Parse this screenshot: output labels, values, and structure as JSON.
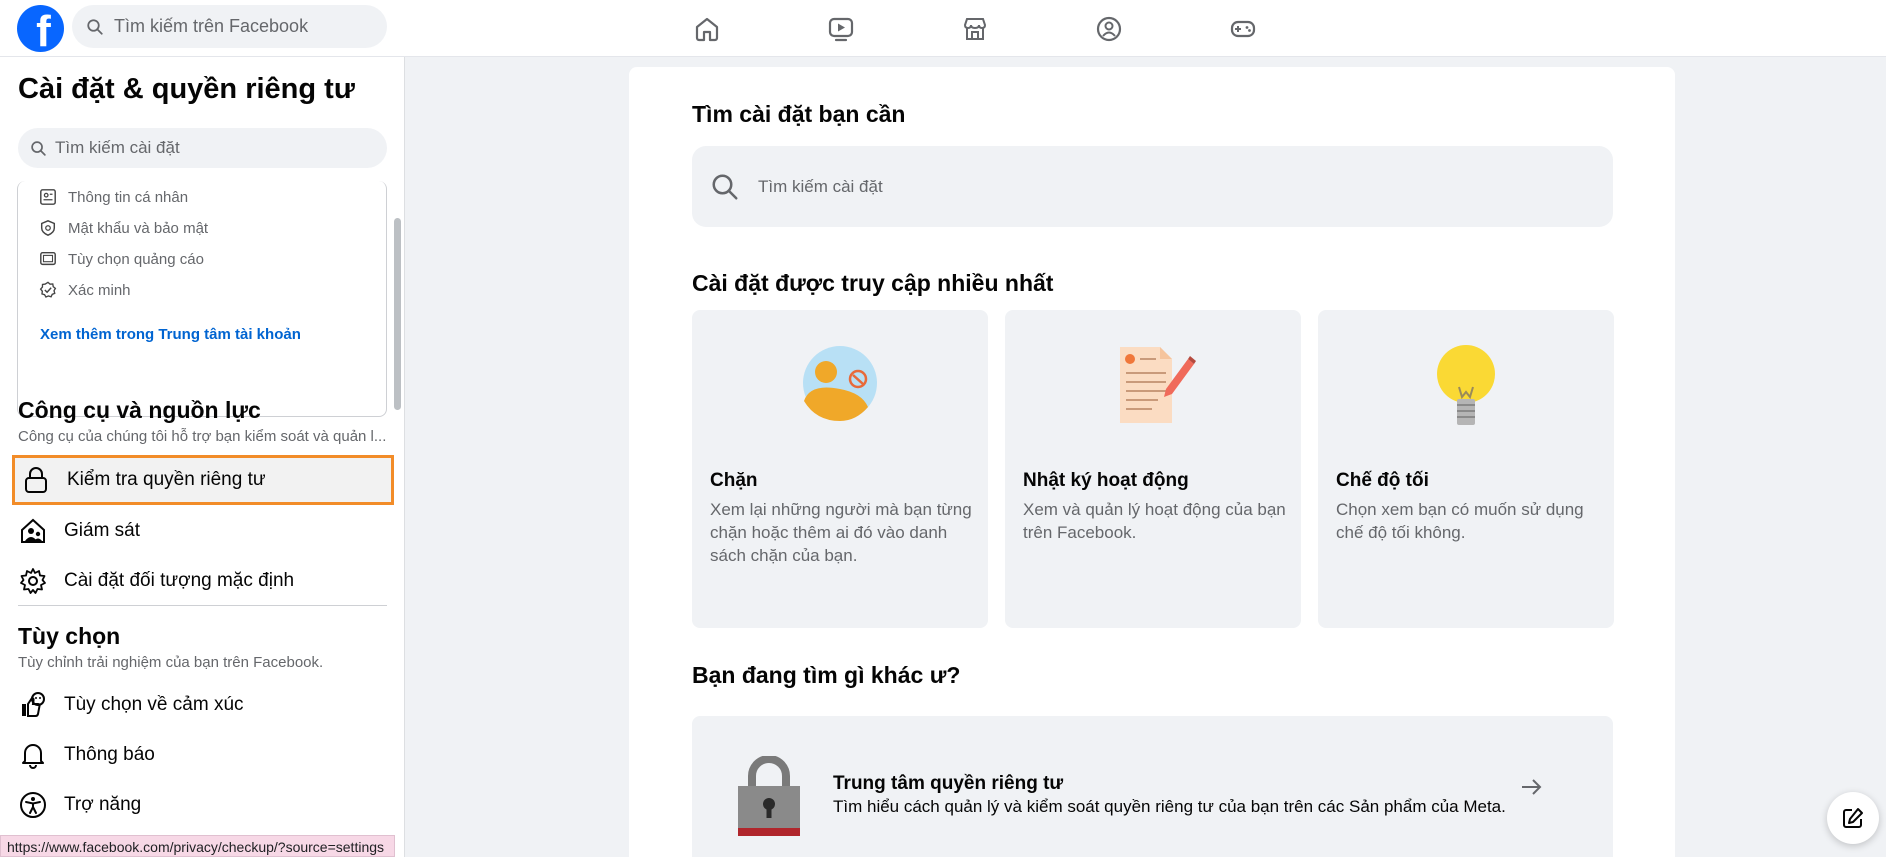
{
  "topbar": {
    "logo_letter": "f",
    "search_placeholder": "Tìm kiếm trên Facebook",
    "nav": [
      "home-icon",
      "video-icon",
      "marketplace-icon",
      "groups-icon",
      "gaming-icon"
    ]
  },
  "sidebar": {
    "title": "Cài đặt & quyền riêng tư",
    "search_placeholder": "Tìm kiếm cài đặt",
    "account_items": [
      {
        "label": "Thông tin cá nhân",
        "icon": "id-card-icon"
      },
      {
        "label": "Mật khẩu và bảo mật",
        "icon": "shield-icon"
      },
      {
        "label": "Tùy chọn quảng cáo",
        "icon": "monitor-icon"
      },
      {
        "label": "Xác minh",
        "icon": "verified-badge-icon"
      }
    ],
    "account_link": "Xem thêm trong Trung tâm tài khoản",
    "tools_section": {
      "title": "Công cụ và nguồn lực",
      "subtitle": "Công cụ của chúng tôi hỗ trợ bạn kiểm soát và quản l...",
      "items": [
        {
          "label": "Kiểm tra quyền riêng tư",
          "icon": "lock-icon",
          "active": true
        },
        {
          "label": "Giám sát",
          "icon": "supervision-icon"
        },
        {
          "label": "Cài đặt đối tượng mặc định",
          "icon": "gear-icon"
        }
      ]
    },
    "prefs_section": {
      "title": "Tùy chọn",
      "subtitle": "Tùy chỉnh trải nghiệm của bạn trên Facebook.",
      "items": [
        {
          "label": "Tùy chọn về cảm xúc",
          "icon": "reactions-icon"
        },
        {
          "label": "Thông báo",
          "icon": "bell-icon"
        },
        {
          "label": "Trợ năng",
          "icon": "accessibility-icon"
        }
      ]
    }
  },
  "main": {
    "search_heading": "Tìm cài đặt bạn cần",
    "search_placeholder": "Tìm kiếm cài đặt",
    "most_visited_heading": "Cài đặt được truy cập nhiều nhất",
    "cards": [
      {
        "title": "Chặn",
        "desc": "Xem lại những người mà bạn từng chặn hoặc thêm ai đó vào danh sách chặn của bạn."
      },
      {
        "title": "Nhật ký hoạt động",
        "desc": "Xem và quản lý hoạt động của bạn trên Facebook."
      },
      {
        "title": "Chế độ tối",
        "desc": "Chọn xem bạn có muốn sử dụng chế độ tối không."
      }
    ],
    "other_heading": "Bạn đang tìm gì khác ư?",
    "privacy_center": {
      "title": "Trung tâm quyền riêng tư",
      "desc": "Tìm hiểu cách quản lý và kiểm soát quyền riêng tư của bạn trên các Sản phẩm của Meta."
    }
  },
  "status_url": "https://www.facebook.com/privacy/checkup/?source=settings",
  "colors": {
    "brand": "#0866ff",
    "link": "#0064d1",
    "highlight": "#f28c28"
  }
}
